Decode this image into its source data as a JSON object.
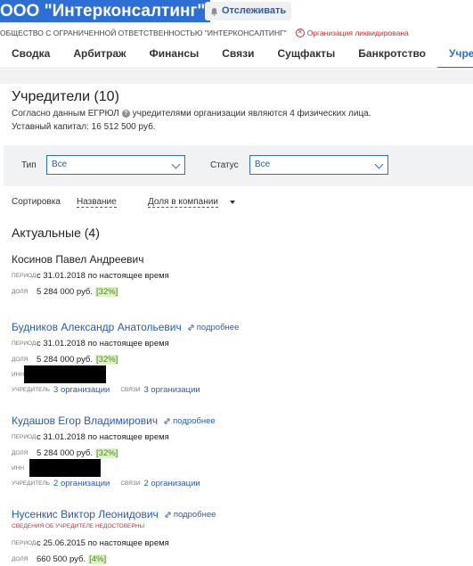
{
  "header": {
    "company_name": "ООО \"Интерконсалтинг\"",
    "follow_label": "Отслеживать",
    "full_name": "ОБЩЕСТВО С ОГРАНИЧЕННОЙ ОТВЕТСТВЕННОСТЬЮ \"ИНТЕРКОНСАЛТИНГ\"",
    "status_text": "Организация ликвидирована",
    "status_color": "#c8302f",
    "accent_color": "#2e6fd6"
  },
  "tabs": [
    {
      "label": "Сводка"
    },
    {
      "label": "Арбитраж"
    },
    {
      "label": "Финансы"
    },
    {
      "label": "Связи"
    },
    {
      "label": "Сущфакты"
    },
    {
      "label": "Банкротство"
    },
    {
      "label": "Учред"
    }
  ],
  "founders": {
    "title": "Учредители (10)",
    "info_prefix": "Согласно данным ЕГРЮЛ",
    "info_suffix": "учредителями организации являются 4 физических лица.",
    "capital": "Уставный капитал: 16 512 500 руб.",
    "filters": {
      "type_label": "Тип",
      "type_value": "Все",
      "status_label": "Статус",
      "status_value": "Все"
    },
    "sort": {
      "label": "Сортировка",
      "by_name": "Название",
      "by_share": "Доля в компании"
    },
    "section_title": "Актуальные (4)",
    "labels": {
      "period": "период",
      "share": "доля",
      "inn": "инн",
      "founder": "учредитель",
      "links": "связи",
      "more": "подробнее"
    },
    "persons": [
      {
        "name": "Косинов Павел Андреевич",
        "period": "с 31.01.2018 по настоящее время",
        "share": "5 284 000 руб.",
        "pct": "[32%]"
      },
      {
        "name": "Будников Александр Анатольевич",
        "period": "с 31.01.2018 по настоящее время",
        "share": "5 284 000 руб.",
        "pct": "[32%]",
        "founder_of": "3 организации",
        "links": "3 организации"
      },
      {
        "name": "Кудашов Егор Владимирович",
        "period": "с 31.01.2018 по настоящее время",
        "share": "5 284 000 руб.",
        "pct": "[32%]",
        "founder_of": "2 организации",
        "links": "2 организации"
      },
      {
        "name": "Нусенкис Виктор Леонидович",
        "warning": "сведения об учредителе недостоверны",
        "period": "с 25.06.2015 по настоящее время",
        "share": "660 500 руб.",
        "pct": "[4%]"
      }
    ]
  }
}
